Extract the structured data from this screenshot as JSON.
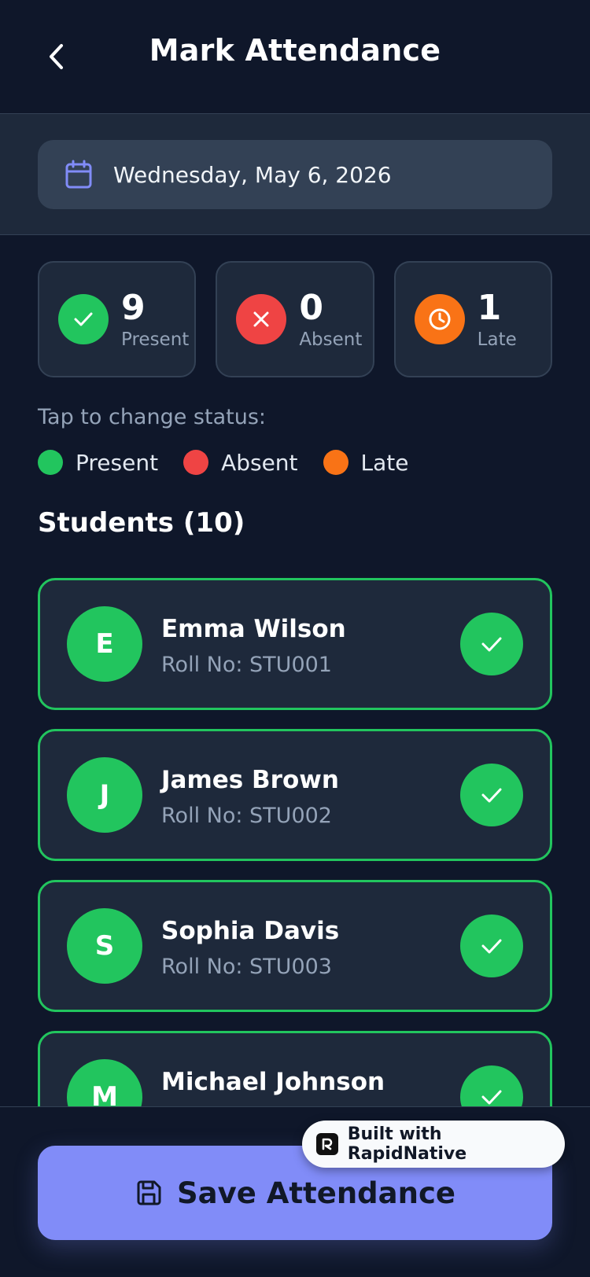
{
  "header": {
    "title": "Mark Attendance",
    "back_icon": "chevron-left-icon"
  },
  "date": {
    "icon": "calendar-icon",
    "text": "Wednesday, May 6, 2026"
  },
  "stats": [
    {
      "key": "present",
      "count": "9",
      "label": "Present",
      "icon": "check-icon",
      "color": "#22c55e"
    },
    {
      "key": "absent",
      "count": "0",
      "label": "Absent",
      "icon": "x-icon",
      "color": "#ef4444"
    },
    {
      "key": "late",
      "count": "1",
      "label": "Late",
      "icon": "clock-icon",
      "color": "#f97316"
    }
  ],
  "hint": "Tap to change status:",
  "legend": [
    {
      "label": "Present",
      "color": "#22c55e"
    },
    {
      "label": "Absent",
      "color": "#ef4444"
    },
    {
      "label": "Late",
      "color": "#f97316"
    }
  ],
  "students_title": "Students (10)",
  "students": [
    {
      "initial": "E",
      "name": "Emma Wilson",
      "roll": "Roll No: STU001",
      "status": "present"
    },
    {
      "initial": "J",
      "name": "James Brown",
      "roll": "Roll No: STU002",
      "status": "present"
    },
    {
      "initial": "S",
      "name": "Sophia Davis",
      "roll": "Roll No: STU003",
      "status": "present"
    },
    {
      "initial": "M",
      "name": "Michael Johnson",
      "roll": "",
      "status": "present"
    }
  ],
  "footer": {
    "save_label": "Save Attendance",
    "save_icon": "save-icon"
  },
  "badge": {
    "text": "Built with RapidNative"
  },
  "colors": {
    "background": "#0f172a",
    "card": "#1e293b",
    "accent": "#818cf8",
    "present": "#22c55e",
    "absent": "#ef4444",
    "late": "#f97316"
  }
}
